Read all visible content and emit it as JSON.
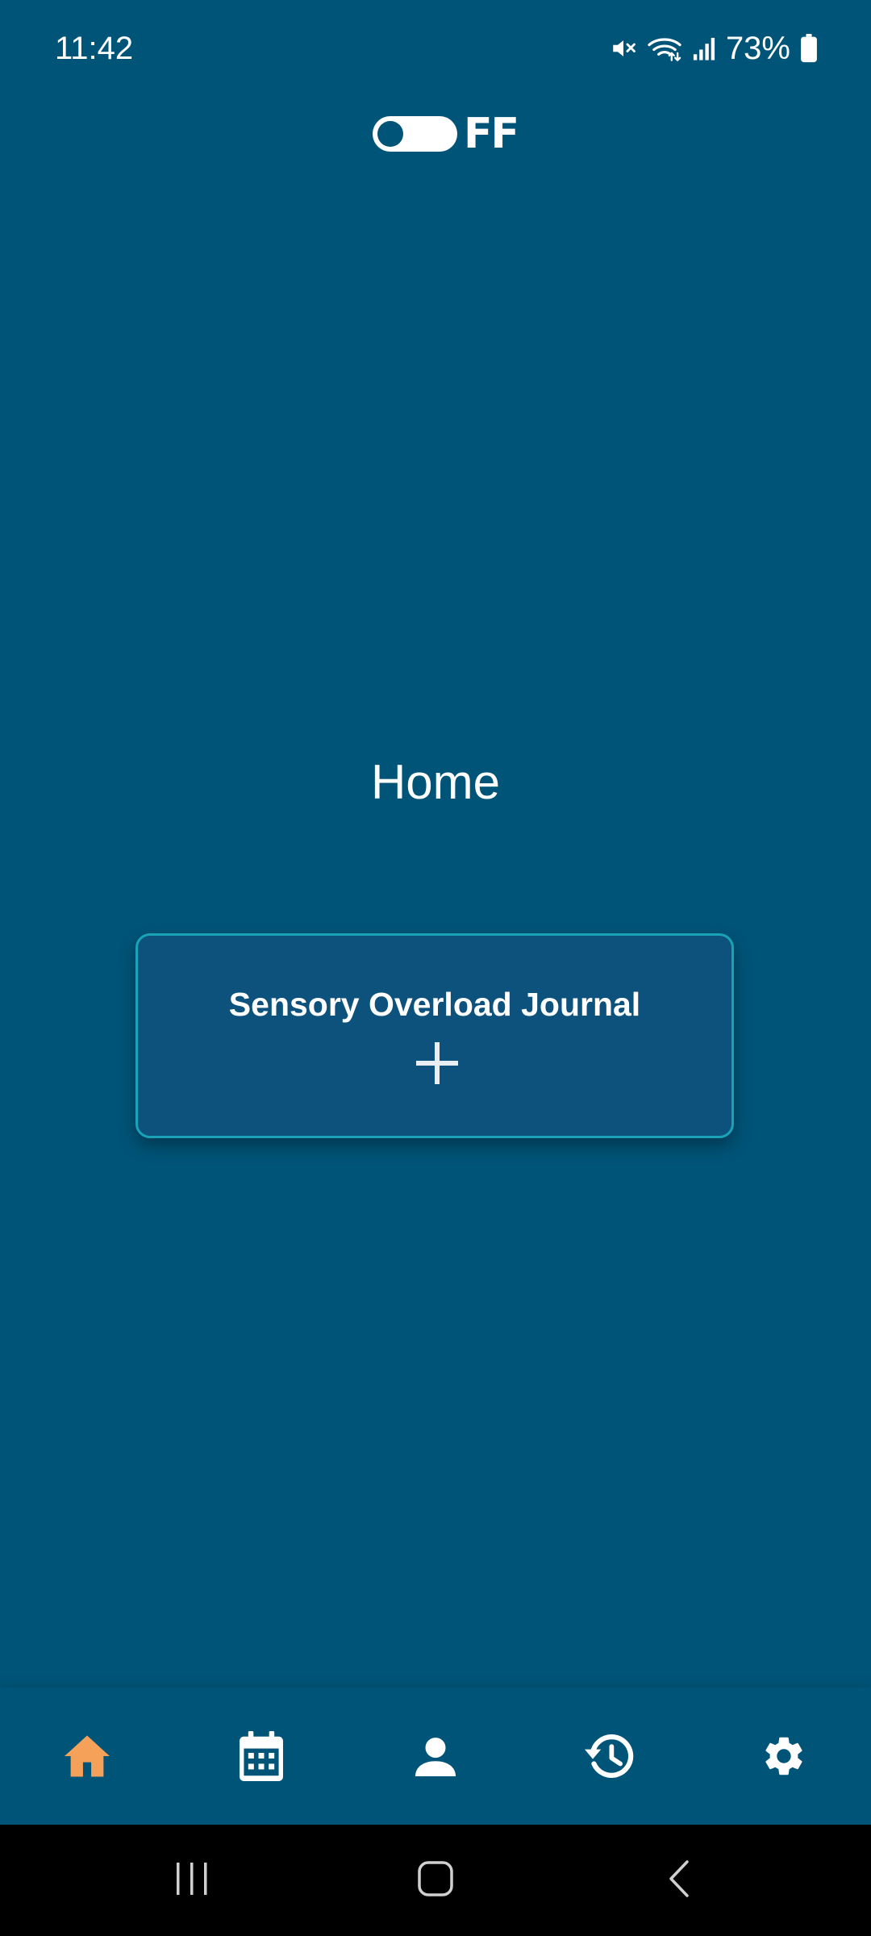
{
  "status_bar": {
    "time": "11:42",
    "battery_percent": "73%",
    "icons": [
      "mute-icon",
      "wifi-icon",
      "signal-icon",
      "battery-icon"
    ]
  },
  "logo": {
    "text": "FF"
  },
  "page": {
    "title": "Home"
  },
  "journal_card": {
    "title": "Sensory Overload Journal",
    "action_icon": "plus-icon"
  },
  "bottom_nav": {
    "active_item": "home",
    "items": [
      {
        "id": "home",
        "icon": "home-icon"
      },
      {
        "id": "calendar",
        "icon": "calendar-icon"
      },
      {
        "id": "profile",
        "icon": "person-icon"
      },
      {
        "id": "history",
        "icon": "history-icon"
      },
      {
        "id": "settings",
        "icon": "gear-icon"
      }
    ]
  },
  "system_nav": {
    "buttons": [
      "recents-icon",
      "home-circle-icon",
      "back-icon"
    ]
  },
  "colors": {
    "background": "#005478",
    "card_background": "#0d527c",
    "card_border": "#1aa3b8",
    "active_nav": "#f6a15a",
    "text": "#ffffff"
  }
}
